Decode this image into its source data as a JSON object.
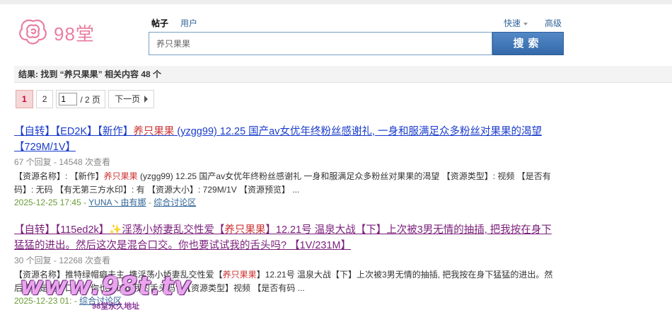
{
  "logo": {
    "text": "98堂",
    "icon": "rose-flower-icon",
    "color": "#e87fa0"
  },
  "search": {
    "tabs": [
      {
        "label": "帖子",
        "active": true
      },
      {
        "label": "用户",
        "active": false
      }
    ],
    "quick_label": "快速",
    "advanced_label": "高级",
    "value": "养只果果",
    "button_label": "搜索"
  },
  "result_summary": "结果: 找到 “养只果果” 相关内容 48 个",
  "pager": {
    "current": "1",
    "page2": "2",
    "input_value": "1",
    "total_text": "/ 2 页",
    "next_label": "下一页"
  },
  "results": [
    {
      "title_before": "【自转】【ED2K】【新作】",
      "title_hl": "养只果果",
      "title_after": " (yzgg99) 12.25 国产av女优年终粉丝感谢礼, 一身和服满足众多粉丝对果果的渴望【729M/1V】",
      "stats": "67 个回复 - 14548 次查看",
      "excerpt_before": "【资源名称】: 【新作】",
      "excerpt_hl": "养只果果",
      "excerpt_after": " (yzgg99) 12.25 国产av女优年终粉丝感谢礼 一身和服满足众多粉丝对果果的渴望 【资源类型】: 视频 【是否有码】: 无码 【有无第三方水印】: 有 【资源大小】: 729M/1V 【资源预览】 ...",
      "date": "2025-12-25 17:45",
      "sep": " - ",
      "author": "YUNA丶由有娜",
      "forum": "综合讨论区"
    },
    {
      "title_before": "【自转】【115ed2k】✨淫荡小娇妻乱交性爱【",
      "title_hl": "养只果果",
      "title_after": "】12.21号 温泉大战【下】上次被3男无情的抽插, 把我按在身下猛猛的进出。然后这次是混合口交。你也要试试我的舌头吗? 【1V/231M】",
      "stats": "30 个回复 - 12268 次查看",
      "excerpt_before": "【资源名称】推特绿帽癖夫主, 携淫荡小娇妻乱交性爱【",
      "excerpt_hl": "养只果果",
      "excerpt_after": "】12.21号 温泉大战【下】上次被3男无情的抽插, 把我按在身下猛猛的进出。然后这次是混合口交。你也要试试我的舌头吗? 【资源类型】视频 【是否有码 ...",
      "date": "2025-12-23 01:",
      "sep": " - ",
      "author": "",
      "forum": "综合讨论区"
    }
  ],
  "watermark": {
    "text": "www.98t.tv",
    "sub": "98堂永久地址"
  },
  "colors": {
    "link": "#1a3ccc",
    "visited": "#7a1f7a",
    "highlight": "#cc3333",
    "button": "#3f75b4",
    "date": "#6b9b37"
  }
}
